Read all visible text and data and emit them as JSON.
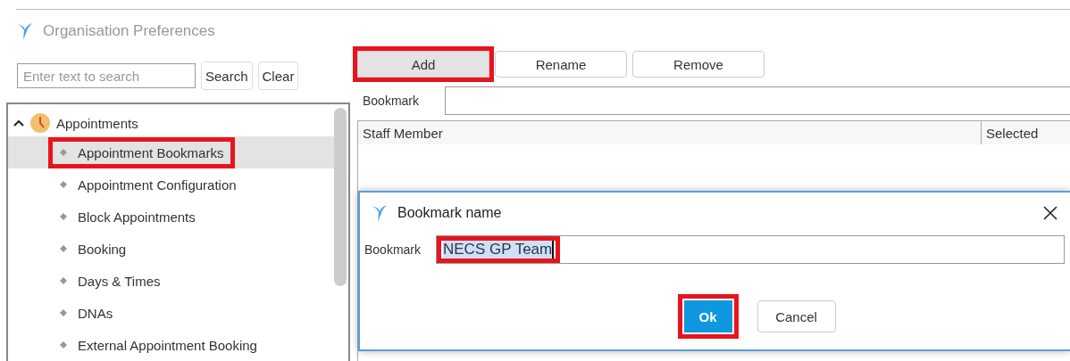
{
  "window": {
    "title": "Organisation Preferences"
  },
  "search": {
    "placeholder": "Enter text to search",
    "buttons": [
      "Search",
      "Clear"
    ]
  },
  "tree": {
    "items": [
      {
        "label": "Appointments",
        "expanded": true,
        "children": [
          {
            "label": "Appointment Bookmarks",
            "selected": true,
            "highlighted": true
          },
          {
            "label": "Appointment Configuration",
            "selected": false,
            "highlighted": false
          },
          {
            "label": "Block Appointments",
            "selected": false,
            "highlighted": false
          },
          {
            "label": "Booking",
            "selected": false,
            "highlighted": false
          },
          {
            "label": "Days & Times",
            "selected": false,
            "highlighted": false
          },
          {
            "label": "DNAs",
            "selected": false,
            "highlighted": false
          },
          {
            "label": "External Appointment Booking",
            "selected": false,
            "highlighted": false
          }
        ]
      }
    ]
  },
  "toolbar": [
    {
      "label": "Add",
      "pressed": true,
      "highlighted": true
    },
    {
      "label": "Rename",
      "pressed": false,
      "highlighted": false
    },
    {
      "label": "Remove",
      "pressed": false,
      "highlighted": false
    }
  ],
  "bookmark_field": {
    "label": "Bookmark"
  },
  "table": {
    "columns": [
      "Staff Member",
      "Selected"
    ]
  },
  "dialog": {
    "title": "Bookmark name",
    "field_label": "Bookmark",
    "value": "NECS GP Team",
    "field_highlighted": true,
    "buttons": [
      {
        "label": "Ok",
        "primary": true,
        "highlighted": true
      },
      {
        "label": "Cancel",
        "primary": false,
        "highlighted": false
      }
    ]
  }
}
